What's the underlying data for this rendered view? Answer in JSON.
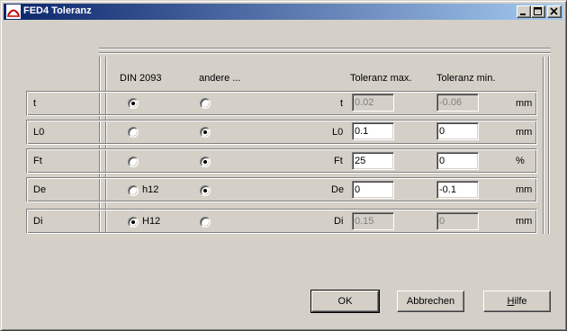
{
  "window": {
    "title": "FED4 Toleranz"
  },
  "headers": {
    "din": "DIN 2093",
    "other": "andere ...",
    "tol_max": "Toleranz max.",
    "tol_min": "Toleranz min."
  },
  "rows": [
    {
      "label": "t",
      "din_option": "",
      "din_checked": true,
      "other_checked": false,
      "enabled": false,
      "max_label": "t",
      "max": "0.02",
      "min": "-0.06",
      "unit": "mm"
    },
    {
      "label": "L0",
      "din_option": "",
      "din_checked": false,
      "other_checked": true,
      "enabled": true,
      "max_label": "L0",
      "max": "0.1",
      "min": "0",
      "unit": "mm"
    },
    {
      "label": "Ft",
      "din_option": "",
      "din_checked": false,
      "other_checked": true,
      "enabled": true,
      "max_label": "Ft",
      "max": "25",
      "min": "0",
      "unit": "%"
    },
    {
      "label": "De",
      "din_option": "h12",
      "din_checked": false,
      "other_checked": true,
      "enabled": true,
      "max_label": "De",
      "max": "0",
      "min": "-0.1",
      "unit": "mm"
    },
    {
      "label": "Di",
      "din_option": "H12",
      "din_checked": true,
      "other_checked": false,
      "enabled": false,
      "max_label": "Di",
      "max": "0.15",
      "min": "0",
      "unit": "mm"
    }
  ],
  "buttons": {
    "ok": "OK",
    "cancel": "Abbrechen",
    "help_prefix": "",
    "help_hotkey": "H",
    "help_rest": "ilfe"
  }
}
